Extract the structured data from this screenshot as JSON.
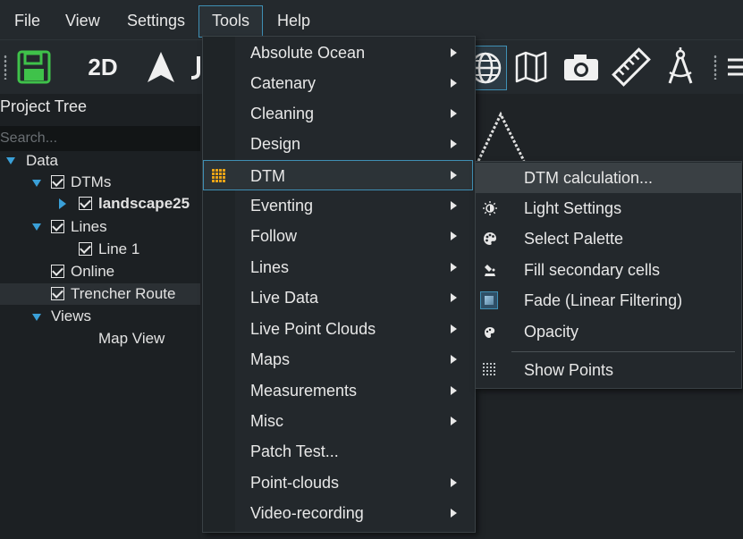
{
  "menubar": {
    "items": [
      "File",
      "View",
      "Settings",
      "Tools",
      "Help"
    ],
    "active": "Tools"
  },
  "toolbar": {
    "mode_2d_label": "2D"
  },
  "project_tree": {
    "title": "Project Tree",
    "search_placeholder": "Search...",
    "nodes": {
      "data": "Data",
      "dtms": "DTMs",
      "landscape": "landscape25",
      "lines": "Lines",
      "line1": "Line 1",
      "online": "Online",
      "trencher": "Trencher Route",
      "views": "Views",
      "map_view": "Map View"
    }
  },
  "tools_menu": {
    "items": [
      {
        "label": "Absolute Ocean",
        "submenu": true
      },
      {
        "label": "Catenary",
        "submenu": true
      },
      {
        "label": "Cleaning",
        "submenu": true
      },
      {
        "label": "Design",
        "submenu": true
      },
      {
        "label": "DTM",
        "submenu": true,
        "highlighted": true,
        "icon": "grid-icon"
      },
      {
        "label": "Eventing",
        "submenu": true
      },
      {
        "label": "Follow",
        "submenu": true
      },
      {
        "label": "Lines",
        "submenu": true
      },
      {
        "label": "Live Data",
        "submenu": true
      },
      {
        "label": "Live Point Clouds",
        "submenu": true
      },
      {
        "label": "Maps",
        "submenu": true
      },
      {
        "label": "Measurements",
        "submenu": true
      },
      {
        "label": "Misc",
        "submenu": true
      },
      {
        "label": "Patch Test...",
        "submenu": false
      },
      {
        "label": "Point-clouds",
        "submenu": true
      },
      {
        "label": "Video-recording",
        "submenu": true
      }
    ]
  },
  "dtm_submenu": {
    "items": [
      {
        "label": "DTM calculation...",
        "icon": "",
        "highlighted": true
      },
      {
        "label": "Light Settings",
        "icon": "light-icon"
      },
      {
        "label": "Select Palette",
        "icon": "palette-icon"
      },
      {
        "label": "Fill secondary cells",
        "icon": "fill-icon"
      },
      {
        "label": "Fade (Linear Filtering)",
        "icon": "fade-icon"
      },
      {
        "label": "Opacity",
        "icon": "opacity-icon"
      },
      {
        "label": "Show Points",
        "icon": "points-icon"
      }
    ]
  },
  "colors": {
    "accent": "#3f8fb4",
    "save_green": "#3fc24a",
    "dtm_icon": "#e8a317"
  }
}
